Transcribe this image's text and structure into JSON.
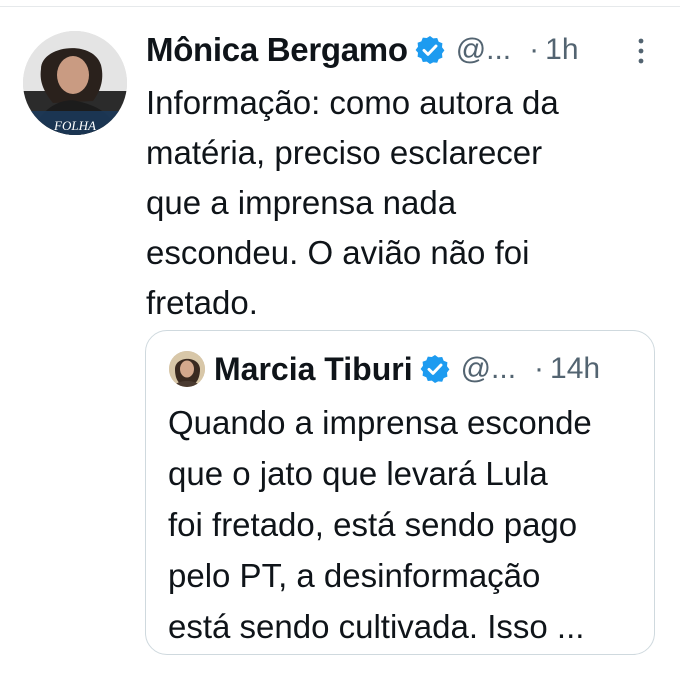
{
  "tweet": {
    "author": {
      "display_name": "Mônica Bergamo",
      "handle": "@...",
      "avatar_badge": "FOLHA",
      "verified_icon": "verified-badge-icon"
    },
    "separator": "·",
    "time": "1h",
    "more_icon": "more-vertical-icon",
    "text": "Informação: como autora da\nmatéria, preciso esclarecer\nque a imprensa nada\nescondeu. O avião não foi\nfretado.",
    "quote": {
      "author": {
        "display_name": "Marcia Tiburi",
        "handle": "@...",
        "verified_icon": "verified-badge-icon"
      },
      "separator": "·",
      "time": "14h",
      "text": "Quando a imprensa esconde\nque o jato que levará Lula\nfoi fretado, está sendo pago\npelo PT, a desinformação\nestá sendo cultivada. Isso ..."
    }
  },
  "colors": {
    "verified_blue": "#1d9bf0",
    "text_primary": "#0f1419",
    "text_secondary": "#536471",
    "quote_border": "#cfd9de"
  }
}
